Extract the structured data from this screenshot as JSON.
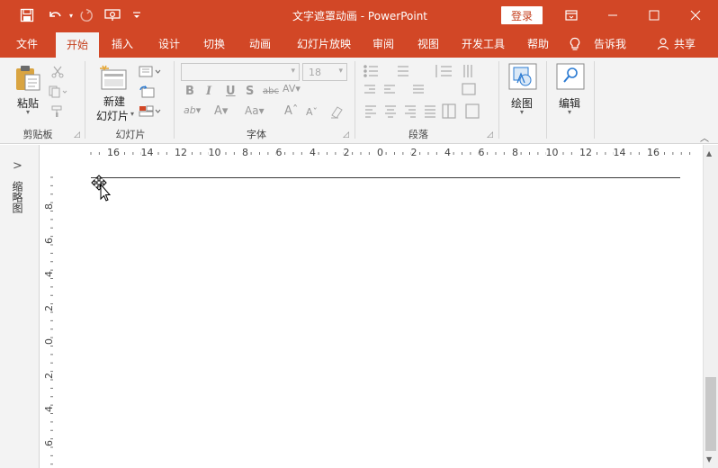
{
  "titlebar": {
    "title": "文字遮罩动画 - PowerPoint",
    "login_label": "登录",
    "icons": [
      "save-icon",
      "undo-icon",
      "redo-icon",
      "present-icon",
      "customize-qat-icon",
      "ribbon-display-icon",
      "minimize-icon",
      "maximize-icon",
      "close-icon"
    ]
  },
  "tabs": [
    "文件",
    "开始",
    "插入",
    "设计",
    "切换",
    "动画",
    "幻灯片放映",
    "审阅",
    "视图",
    "开发工具",
    "帮助"
  ],
  "active_tab": "开始",
  "tell_me": "告诉我",
  "share": "共享",
  "ribbon": {
    "clipboard": {
      "paste_label": "粘贴",
      "group_label": "剪贴板"
    },
    "slides": {
      "new_slide_label_1": "新建",
      "new_slide_label_2": "幻灯片",
      "group_label": "幻灯片"
    },
    "font": {
      "font_size": "18",
      "group_label": "字体"
    },
    "paragraph": {
      "group_label": "段落"
    },
    "drawing": {
      "label": "绘图"
    },
    "editing": {
      "label": "编辑"
    }
  },
  "left_pane": {
    "label": "缩略图"
  },
  "ruler": {
    "h_labels": [
      "16",
      "14",
      "12",
      "10",
      "8",
      "6",
      "4",
      "2",
      "0",
      "2",
      "4",
      "6",
      "8",
      "10",
      "12",
      "14",
      "16"
    ],
    "v_labels": [
      "8",
      "6",
      "4",
      "2",
      "0",
      "2",
      "4",
      "6"
    ]
  },
  "colors": {
    "accent": "#d24726",
    "ribbon_bg": "#f3f3f3"
  }
}
